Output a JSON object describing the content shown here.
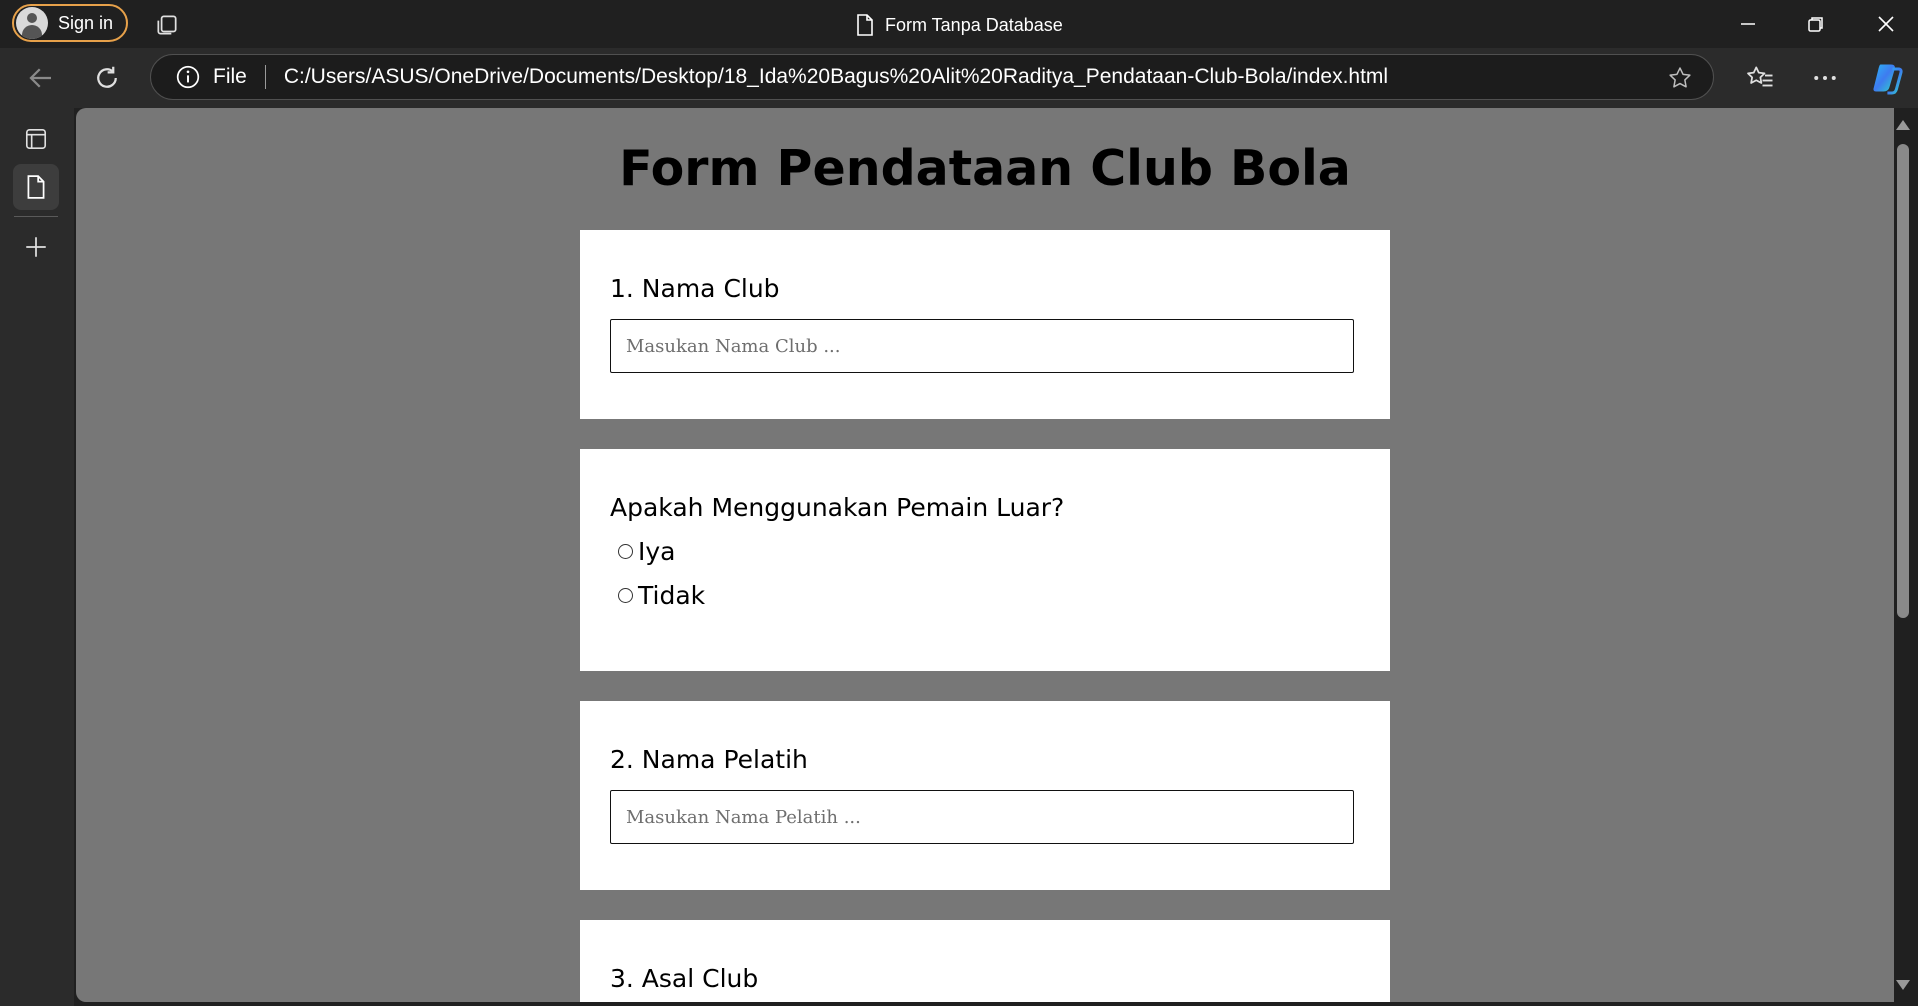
{
  "browser": {
    "signin_label": "Sign in",
    "window_title": "Form Tanpa Database",
    "address": {
      "scheme_label": "File",
      "url": "C:/Users/ASUS/OneDrive/Documents/Desktop/18_Ida%20Bagus%20Alit%20Raditya_Pendataan-Club-Bola/index.html"
    },
    "icons": {
      "collections": "collections-icon",
      "page": "page-icon",
      "back": "back-arrow-icon",
      "refresh": "refresh-icon",
      "info": "info-icon",
      "favorite": "star-icon",
      "favorites_list": "favorites-icon",
      "more": "more-icon",
      "copilot": "copilot-icon",
      "minimize": "minimize-icon",
      "restore": "restore-icon",
      "close": "close-icon"
    },
    "accent_color": "#e7a14a"
  },
  "page": {
    "title": "Form Pendataan Club Bola",
    "background": "#777777",
    "fields": {
      "club_name": {
        "label": "1. Nama Club",
        "placeholder": "Masukan Nama Club ...",
        "value": ""
      },
      "foreign_players": {
        "question": "Apakah Menggunakan Pemain Luar?",
        "options": [
          "Iya",
          "Tidak"
        ],
        "selected": null
      },
      "coach_name": {
        "label": "2. Nama Pelatih",
        "placeholder": "Masukan Nama Pelatih ...",
        "value": ""
      },
      "club_origin": {
        "label": "3. Asal Club"
      }
    }
  }
}
